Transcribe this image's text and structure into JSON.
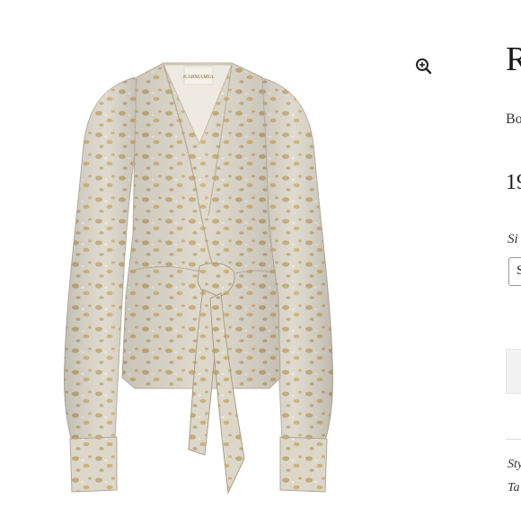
{
  "product": {
    "title": "R",
    "brand": "Bo",
    "price": "19",
    "size_label": "Si",
    "size_value": "S",
    "meta_line_1": "Sty",
    "meta_line_2": "Ta",
    "image_label_text": "KARMAMIA"
  },
  "icons": {
    "zoom": "zoom-in-icon"
  },
  "colors": {
    "fabric_base": "#d9d3c6",
    "fabric_gold": "#b89a5a",
    "text": "#1a1a1a"
  }
}
